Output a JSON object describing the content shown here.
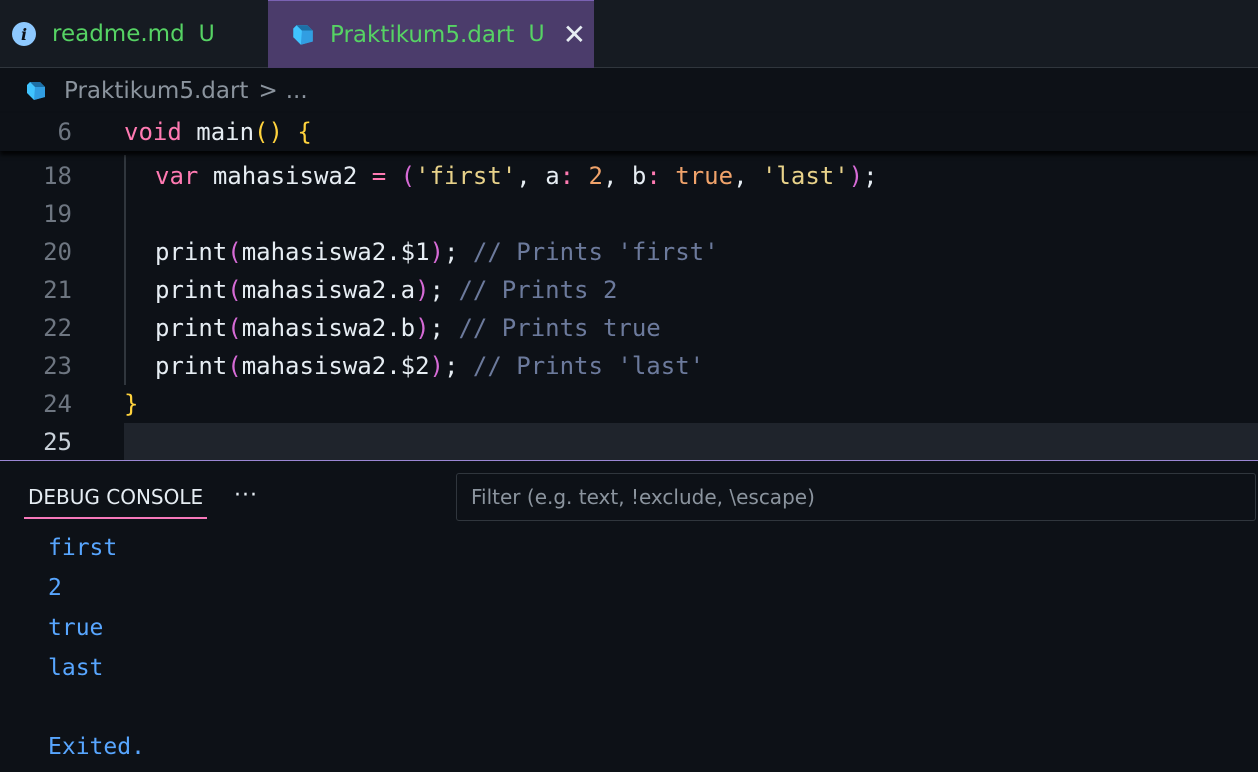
{
  "tabs": [
    {
      "label": "readme.md",
      "status": "U",
      "icon": "info-icon"
    },
    {
      "label": "Praktikum5.dart",
      "status": "U",
      "icon": "dart-icon",
      "active": true
    }
  ],
  "breadcrumb": {
    "file": "Praktikum5.dart",
    "separator": ">",
    "more": "..."
  },
  "editor": {
    "sticky": {
      "line": "6"
    },
    "lines": [
      {
        "n": "18"
      },
      {
        "n": "19"
      },
      {
        "n": "20"
      },
      {
        "n": "21"
      },
      {
        "n": "22"
      },
      {
        "n": "23"
      },
      {
        "n": "24"
      },
      {
        "n": "25"
      }
    ],
    "tokens": {
      "void": "void",
      "main": "main",
      "lparen": "(",
      "rparen": ")",
      "lbrace": "{",
      "var": "var",
      "mahasiswa2": "mahasiswa2",
      "eq": "=",
      "first": "'first'",
      "comma": ",",
      "a": "a",
      "colon": ":",
      "two": "2",
      "b": "b",
      "true": "true",
      "last": "'last'",
      "semi": ";",
      "print": "print",
      "m1": "mahasiswa2.$1",
      "ma": "mahasiswa2.a",
      "mb": "mahasiswa2.b",
      "m2": "mahasiswa2.$2",
      "c1": "// Prints 'first'",
      "c2": "// Prints 2",
      "c3": "// Prints true",
      "c4": "// Prints 'last'",
      "rbrace": "}"
    }
  },
  "panel": {
    "tab": "DEBUG CONSOLE",
    "more": "···",
    "filter_placeholder": "Filter (e.g. text, !exclude, \\escape)",
    "output": [
      "first",
      "2",
      "true",
      "last",
      "Exited."
    ]
  },
  "colors": {
    "accent": "#4b3c6b",
    "modified": "#56d364",
    "console": "#58a6ff"
  }
}
